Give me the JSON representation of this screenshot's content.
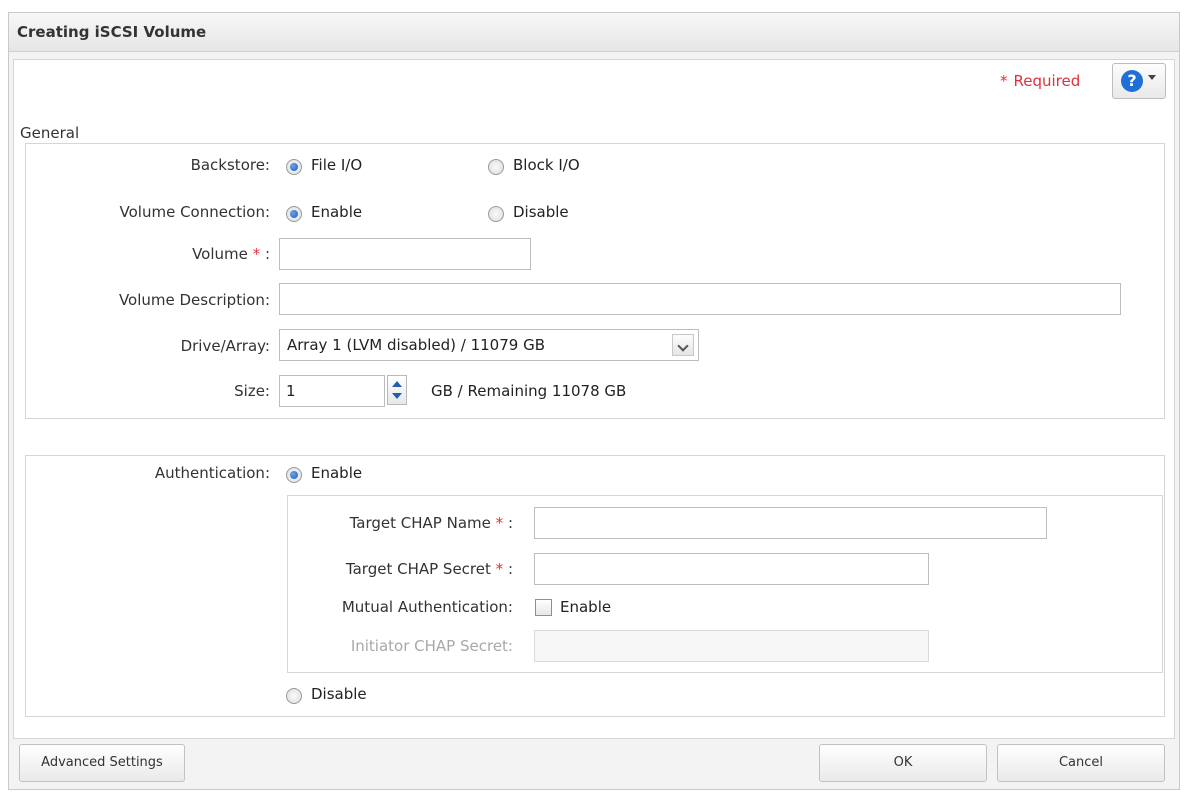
{
  "dialog": {
    "title": "Creating iSCSI Volume",
    "required_star": "*",
    "required_label": "Required",
    "help_icon_glyph": "?",
    "section_general": "General"
  },
  "general": {
    "backstore_label": "Backstore:",
    "backstore_options": [
      "File I/O",
      "Block I/O"
    ],
    "backstore_selected": "File I/O",
    "volume_connection_label": "Volume Connection:",
    "volume_connection_options": [
      "Enable",
      "Disable"
    ],
    "volume_connection_selected": "Enable",
    "volume_label": "Volume",
    "volume_value": "",
    "volume_description_label": "Volume Description:",
    "volume_description_value": "",
    "drive_array_label": "Drive/Array:",
    "drive_array_value": "Array 1 (LVM disabled) / 11079 GB",
    "size_label": "Size:",
    "size_value": "1",
    "size_remaining_text": "GB / Remaining 11078 GB"
  },
  "authentication": {
    "label": "Authentication:",
    "enable_label": "Enable",
    "disable_label": "Disable",
    "selected": "Enable",
    "target_chap_name_label": "Target CHAP Name",
    "target_chap_name_value": "",
    "target_chap_secret_label": "Target CHAP Secret",
    "target_chap_secret_value": "",
    "mutual_auth_label": "Mutual Authentication:",
    "mutual_auth_checkbox_label": "Enable",
    "mutual_auth_checked": false,
    "initiator_chap_secret_label": "Initiator CHAP Secret:",
    "initiator_chap_secret_value": ""
  },
  "footer": {
    "advanced_settings": "Advanced Settings",
    "ok": "OK",
    "cancel": "Cancel"
  },
  "colors": {
    "required_red": "#e0303a",
    "radio_blue": "#1d5cb8",
    "help_blue": "#1f6fd6"
  },
  "icons": [
    "help-icon",
    "chevron-down-icon",
    "stepper-up-icon",
    "stepper-down-icon"
  ]
}
